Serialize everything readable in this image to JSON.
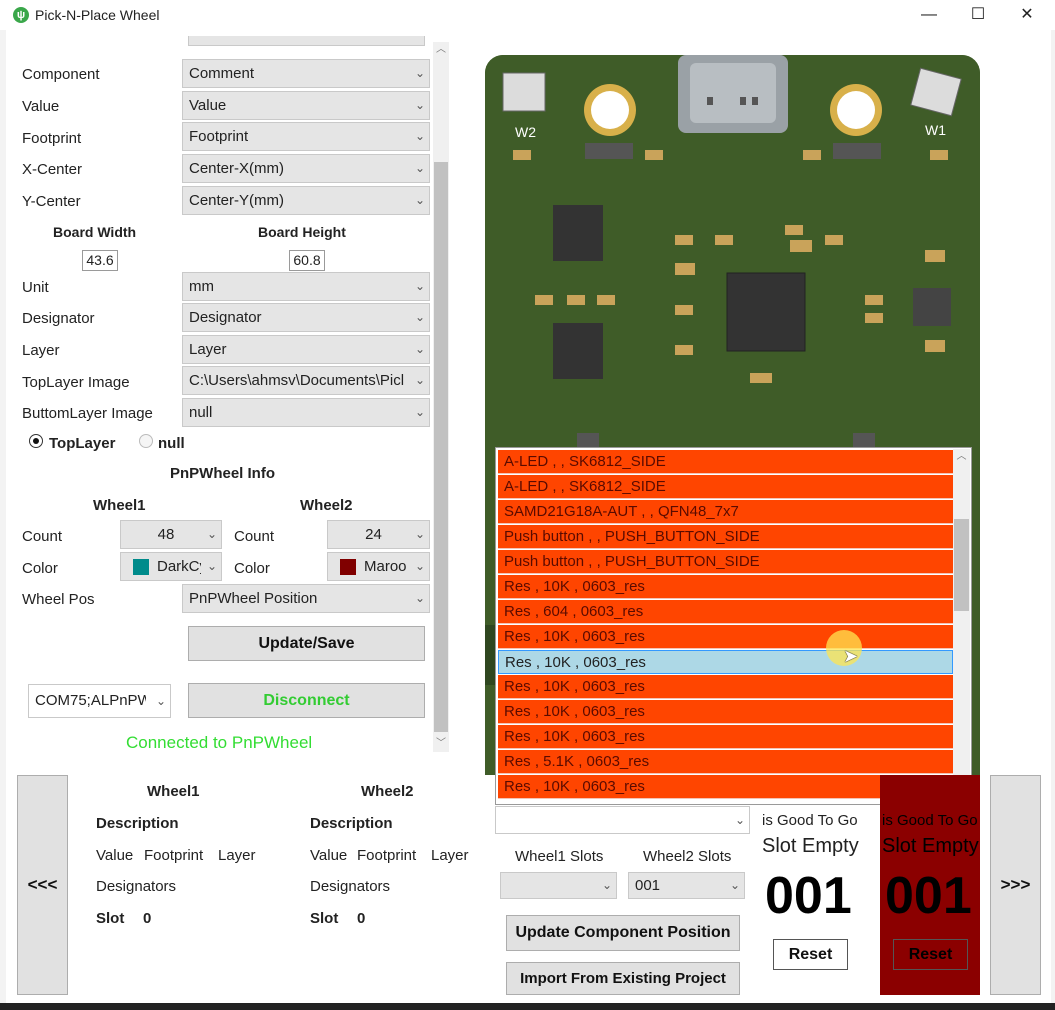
{
  "window": {
    "title": "Pick-N-Place Wheel",
    "minimize": "—",
    "maximize": "☐",
    "close": "✕"
  },
  "form": {
    "component": {
      "label": "Component",
      "value": "Comment"
    },
    "value": {
      "label": "Value",
      "value": "Value"
    },
    "footprint": {
      "label": "Footprint",
      "value": "Footprint"
    },
    "xcenter": {
      "label": "X-Center",
      "value": "Center-X(mm)"
    },
    "ycenter": {
      "label": "Y-Center",
      "value": "Center-Y(mm)"
    },
    "board_width": {
      "label": "Board Width",
      "value": "43.6"
    },
    "board_height": {
      "label": "Board Height",
      "value": "60.8"
    },
    "unit": {
      "label": "Unit",
      "value": "mm"
    },
    "designator": {
      "label": "Designator",
      "value": "Designator"
    },
    "layer": {
      "label": "Layer",
      "value": "Layer"
    },
    "top_image": {
      "label": "TopLayer Image",
      "value": "C:\\Users\\ahmsv\\Documents\\Picl"
    },
    "bottom_image": {
      "label": "ButtomLayer Image",
      "value": "null"
    },
    "radio_top": "TopLayer",
    "radio_null": "null",
    "info_title": "PnPWheel Info",
    "wheel1": {
      "title": "Wheel1",
      "count_label": "Count",
      "count": "48",
      "color_label": "Color",
      "color_name": "DarkCy",
      "swatch": "#008b8b"
    },
    "wheel2": {
      "title": "Wheel2",
      "count_label": "Count",
      "count": "24",
      "color_label": "Color",
      "color_name": "Maroo",
      "swatch": "#800000"
    },
    "wheel_pos": {
      "label": "Wheel Pos",
      "value": "PnPWheel Position"
    },
    "update_save": "Update/Save",
    "com_port": "COM75;ALPnPW",
    "disconnect": "Disconnect",
    "status": "Connected to PnPWheel"
  },
  "components_list": {
    "items": [
      "A-LED ,  , SK6812_SIDE",
      "A-LED ,  , SK6812_SIDE",
      "SAMD21G18A-AUT ,  , QFN48_7x7",
      "Push button ,  , PUSH_BUTTON_SIDE",
      "Push button ,  , PUSH_BUTTON_SIDE",
      "Res , 10K , 0603_res",
      "Res , 604 , 0603_res",
      "Res , 10K , 0603_res",
      "Res , 10K , 0603_res",
      "Res , 10K , 0603_res",
      "Res , 10K , 0603_res",
      "Res , 10K , 0603_res",
      "Res , 5.1K , 0603_res",
      "Res , 10K , 0603_res"
    ],
    "selected_index": 8,
    "item_color": "#ff4500",
    "selected_color": "#add8e6"
  },
  "pcb": {
    "w1": "W1",
    "w2": "W2"
  },
  "bottom": {
    "prev": "<<<",
    "next": ">>>",
    "wheel1": {
      "title": "Wheel1",
      "description": "Description",
      "value": "Value",
      "footprint": "Footprint",
      "layer": "Layer",
      "designators": "Designators",
      "slot_label": "Slot",
      "slot": "0"
    },
    "wheel2": {
      "title": "Wheel2",
      "description": "Description",
      "value": "Value",
      "footprint": "Footprint",
      "layer": "Layer",
      "designators": "Designators",
      "slot_label": "Slot",
      "slot": "0"
    },
    "wheel1_slots_label": "Wheel1 Slots",
    "wheel2_slots_label": "Wheel2 Slots",
    "wheel1_slots_value": "",
    "wheel2_slots_value": "001",
    "update_position": "Update Component Position",
    "import_project": "Import From Existing Project",
    "panel1": {
      "good": "is Good To Go",
      "empty": "Slot Empty",
      "slot": "001",
      "reset": "Reset"
    },
    "panel2": {
      "good": "is Good To Go",
      "empty": "Slot Empty",
      "slot": "001",
      "reset": "Reset",
      "bg": "#8b0000"
    }
  }
}
